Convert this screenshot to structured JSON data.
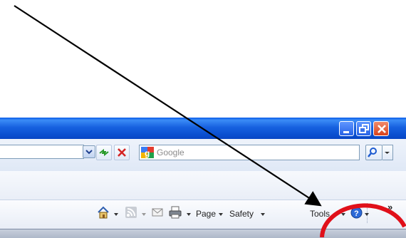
{
  "search": {
    "placeholder": "Google",
    "provider_icon": "google-logo-icon"
  },
  "address": {
    "dropdown_icon": "chevron-down-icon"
  },
  "window_controls": {
    "minimize_icon": "minimize-icon",
    "maximize_icon": "restore-icon",
    "close_icon": "close-icon"
  },
  "command_bar": {
    "home_icon": "home-icon",
    "feeds_icon": "rss-feed-icon",
    "mail_icon": "mail-icon",
    "print_icon": "printer-icon",
    "page_label": "Page",
    "safety_label": "Safety",
    "tools_label": "Tools",
    "help_icon": "help-icon",
    "more_label": "»"
  },
  "annotation": {
    "arrow_target": "Tools",
    "arrow_color": "#000000",
    "circle_color": "#e0101a"
  },
  "colors": {
    "titlebar": "#1761e0",
    "close_button": "#d9421c"
  }
}
